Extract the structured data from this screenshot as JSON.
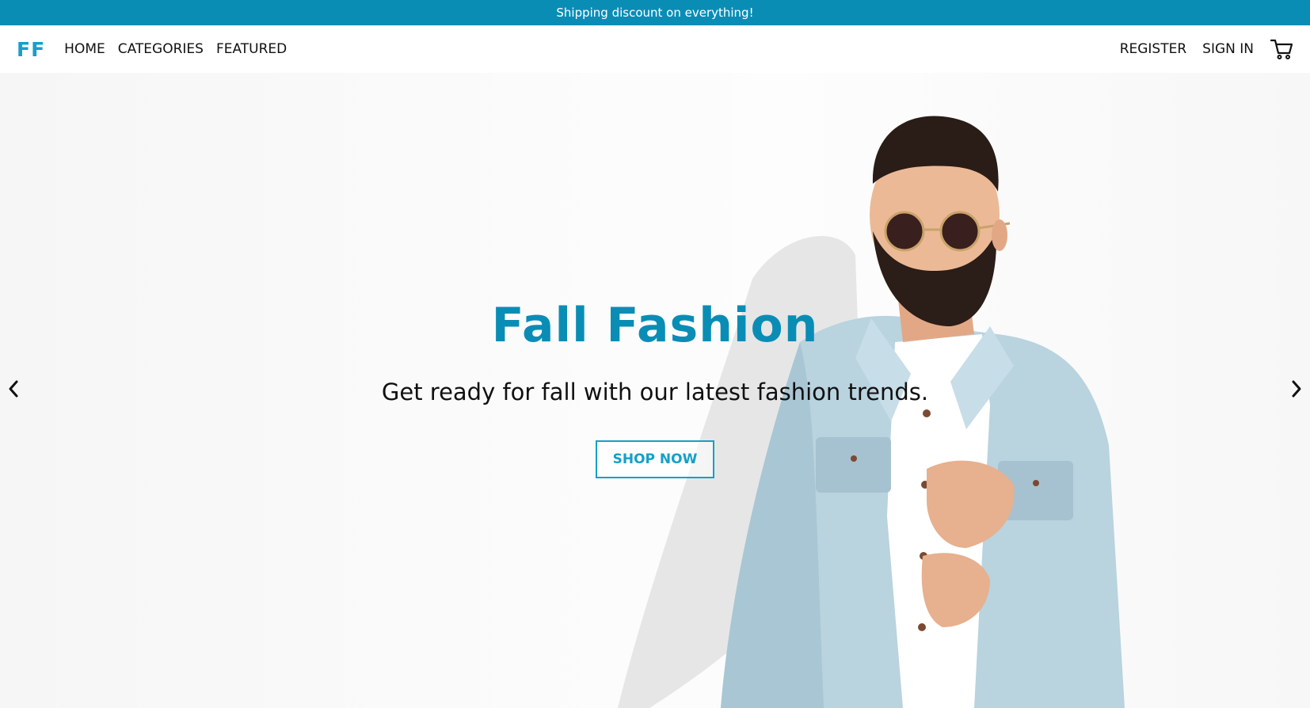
{
  "promo": {
    "text": "Shipping discount on everything!"
  },
  "nav": {
    "logo": "FF",
    "left_links": [
      "HOME",
      "CATEGORIES",
      "FEATURED"
    ],
    "right_links": [
      "REGISTER",
      "SIGN IN"
    ],
    "cart_icon": "shopping-cart-icon"
  },
  "hero": {
    "title": "Fall Fashion",
    "subtitle": "Get ready for fall with our latest fashion trends.",
    "cta_label": "SHOP NOW",
    "prev_icon": "chevron-left-icon",
    "next_icon": "chevron-right-icon"
  },
  "colors": {
    "accent": "#0a8db5",
    "accent_light": "#14a0c9",
    "text": "#111111",
    "background": "#ffffff"
  }
}
